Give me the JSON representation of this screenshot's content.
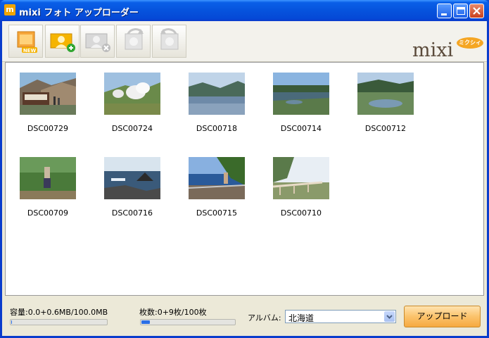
{
  "window": {
    "app_icon_letter": "m",
    "title": "mixi フォト アップローダー"
  },
  "toolbar": {
    "buttons": [
      {
        "name": "new-album",
        "icon": "new-album-icon",
        "enabled": true
      },
      {
        "name": "add-photo",
        "icon": "add-photo-icon",
        "enabled": true
      },
      {
        "name": "remove-photo",
        "icon": "remove-photo-icon",
        "enabled": false
      },
      {
        "name": "rotate-left",
        "icon": "rotate-left-icon",
        "enabled": false
      },
      {
        "name": "rotate-right",
        "icon": "rotate-right-icon",
        "enabled": false
      }
    ],
    "logo_text": "mixi",
    "logo_badge": "ミクシィ"
  },
  "photos": [
    {
      "name": "DSC00729"
    },
    {
      "name": "DSC00724"
    },
    {
      "name": "DSC00718"
    },
    {
      "name": "DSC00714"
    },
    {
      "name": "DSC00712"
    },
    {
      "name": "DSC00709"
    },
    {
      "name": "DSC00716"
    },
    {
      "name": "DSC00715"
    },
    {
      "name": "DSC00710"
    }
  ],
  "status": {
    "capacity_label": "容量:0.0+0.6MB/100.0MB",
    "capacity_fraction": 0.006,
    "count_label": "枚数:0+9枚/100枚",
    "count_fraction": 0.09,
    "album_label": "アルバム:",
    "album_value": "北海道",
    "upload_label": "アップロード"
  },
  "colors": {
    "titlebar": "#0653dd",
    "progress": "#2b6fe6",
    "upload_button": "#f6a93f"
  }
}
